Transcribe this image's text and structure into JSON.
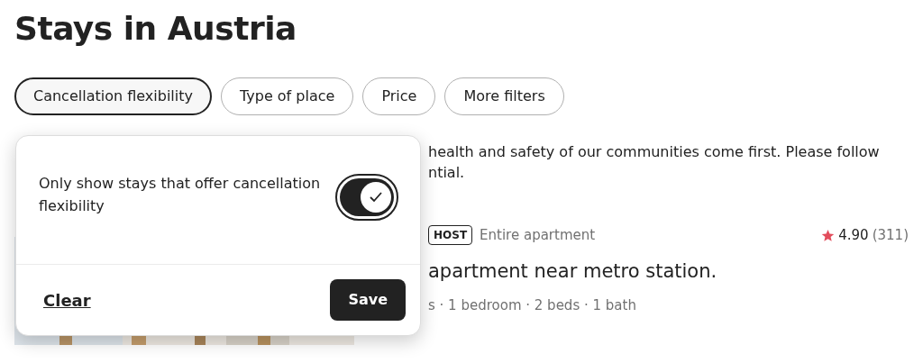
{
  "title": "Stays in Austria",
  "filters": [
    {
      "label": "Cancellation flexibility",
      "selected": true
    },
    {
      "label": "Type of place",
      "selected": false
    },
    {
      "label": "Price",
      "selected": false
    },
    {
      "label": "More filters",
      "selected": false
    }
  ],
  "notice": {
    "lines": [
      "health and safety of our communities come first. Please follow",
      "ntial."
    ]
  },
  "listing": {
    "badge": "HOST",
    "type": "Entire apartment",
    "rating": "4.90",
    "reviews": "(311)",
    "name": "apartment near metro station.",
    "details": "s · 1 bedroom · 2 beds · 1 bath"
  },
  "popover": {
    "option": "Only show stays that offer cancellation flexibility",
    "checked": true,
    "clear": "Clear",
    "save": "Save"
  }
}
